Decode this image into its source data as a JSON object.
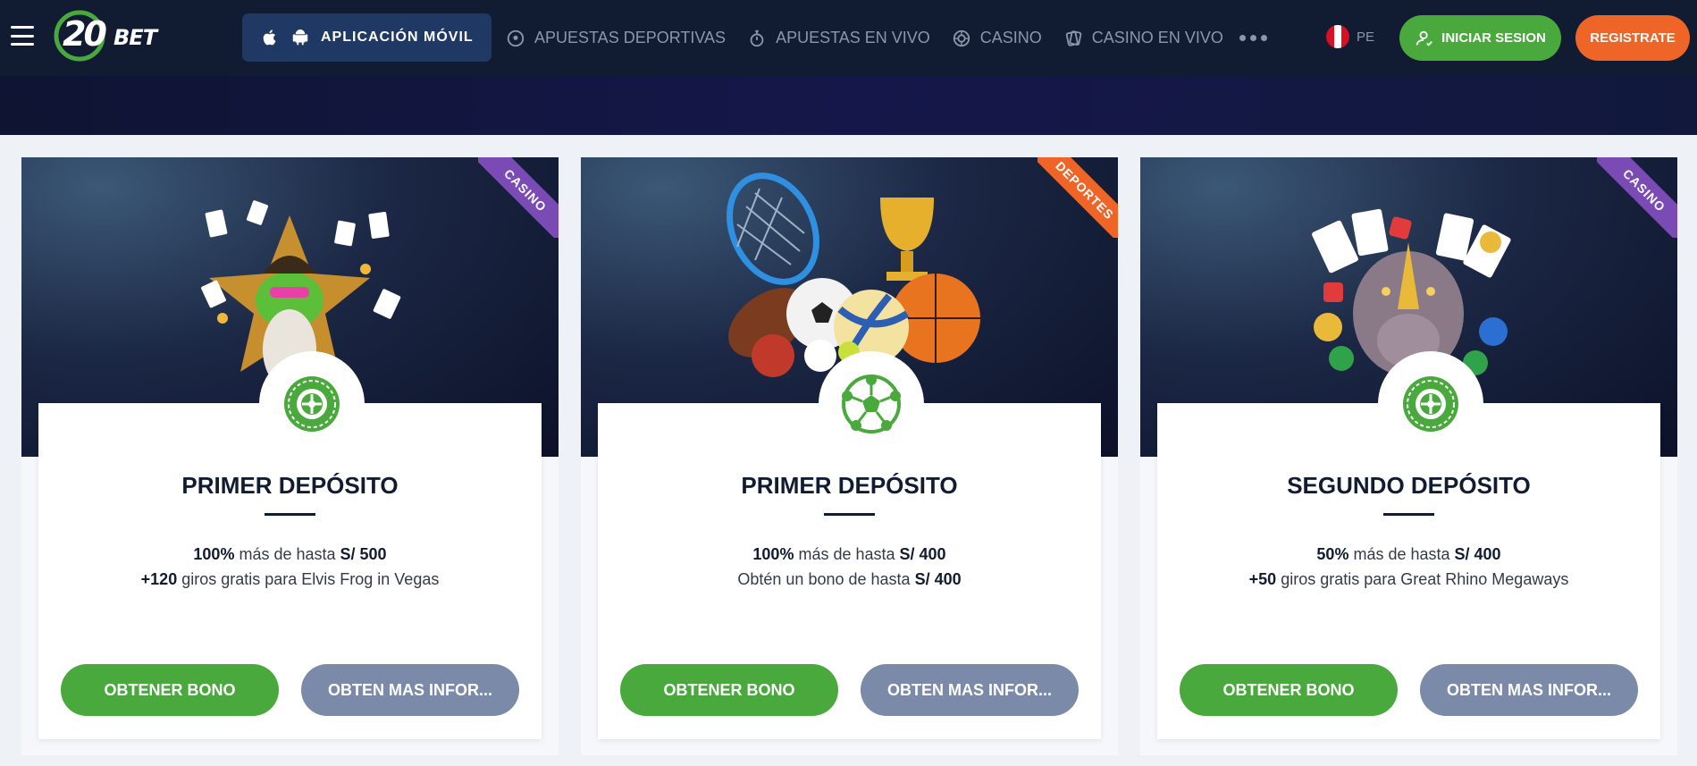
{
  "header": {
    "logo_text_number": "20",
    "logo_text_word": "BET",
    "app_button_label": "APLICACIÓN MÓVIL",
    "nav_items": [
      {
        "label": "APUESTAS DEPORTIVAS",
        "icon": "soccer-ball-icon"
      },
      {
        "label": "APUESTAS EN VIVO",
        "icon": "stopwatch-icon"
      },
      {
        "label": "CASINO",
        "icon": "roulette-icon"
      },
      {
        "label": "CASINO EN VIVO",
        "icon": "cards-icon"
      }
    ],
    "more_icon": "more-dots-icon",
    "language_code": "PE",
    "login_label": "INICIAR SESION",
    "register_label": "REGISTRATE"
  },
  "colors": {
    "header_bg": "#111c33",
    "green": "#4aa93d",
    "orange": "#ee6527",
    "purple": "#7a4bb4",
    "gray_button": "#7a8aa8"
  },
  "cards": [
    {
      "tag": "CASINO",
      "badge_icon": "roulette-icon",
      "title": "PRIMER DEPÓSITO",
      "line1_bold": "100%",
      "line1_text": " más de hasta ",
      "line1_amount": "S/ 500",
      "line2_bold": "+120",
      "line2_text": " giros gratis para Elvis Frog in Vegas",
      "line2_amount": "",
      "primary_button": "OBTENER BONO",
      "secondary_button": "OBTEN MAS INFOR..."
    },
    {
      "tag": "DEPORTES",
      "badge_icon": "soccer-ball-icon",
      "title": "PRIMER DEPÓSITO",
      "line1_bold": "100%",
      "line1_text": " más de hasta ",
      "line1_amount": "S/ 400",
      "line2_bold": "",
      "line2_text": "Obtén un bono de hasta ",
      "line2_amount": "S/ 400",
      "primary_button": "OBTENER BONO",
      "secondary_button": "OBTEN MAS INFOR..."
    },
    {
      "tag": "CASINO",
      "badge_icon": "roulette-icon",
      "title": "SEGUNDO DEPÓSITO",
      "line1_bold": "50%",
      "line1_text": " más de hasta ",
      "line1_amount": "S/ 400",
      "line2_bold": "+50",
      "line2_text": " giros gratis para Great Rhino Megaways",
      "line2_amount": "",
      "primary_button": "OBTENER BONO",
      "secondary_button": "OBTEN MAS INFOR..."
    }
  ]
}
